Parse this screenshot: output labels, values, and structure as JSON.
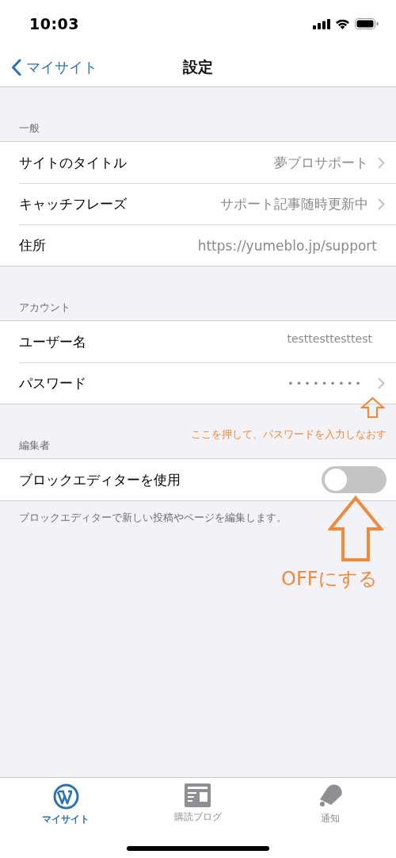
{
  "status_bar": {
    "time": "10:03"
  },
  "nav": {
    "back": "マイサイト",
    "title": "設定"
  },
  "sections": [
    {
      "header": "一般",
      "rows": [
        {
          "kind": "disclosure",
          "label": "サイトのタイトル",
          "value": "夢ブロサポート"
        },
        {
          "kind": "disclosure",
          "label": "キャッチフレーズ",
          "value": "サポート記事随時更新中"
        },
        {
          "kind": "value",
          "label": "住所",
          "value": "https://yumeblo.jp/support"
        }
      ]
    },
    {
      "header": "アカウント",
      "rows": [
        {
          "kind": "value",
          "label": "ユーザー名",
          "value": "testtesttesttest"
        },
        {
          "kind": "disclosure",
          "label": "パスワード",
          "value": "•••••••••"
        }
      ]
    },
    {
      "header": "編集者",
      "rows": [
        {
          "kind": "toggle",
          "label": "ブロックエディターを使用",
          "on": false
        }
      ],
      "footer": "ブロックエディターで新しい投稿やページを編集します。"
    }
  ],
  "annotations": [
    {
      "kind": "small",
      "text": "ここを押して、パスワードを入力しなおす"
    },
    {
      "kind": "large",
      "text": "OFFにする"
    }
  ],
  "tab_bar": [
    {
      "kind": "wordpress",
      "label": "マイサイト",
      "selected": true
    },
    {
      "kind": "reader",
      "label": "購読ブログ",
      "selected": false
    },
    {
      "kind": "bell",
      "label": "通知",
      "selected": false
    }
  ]
}
